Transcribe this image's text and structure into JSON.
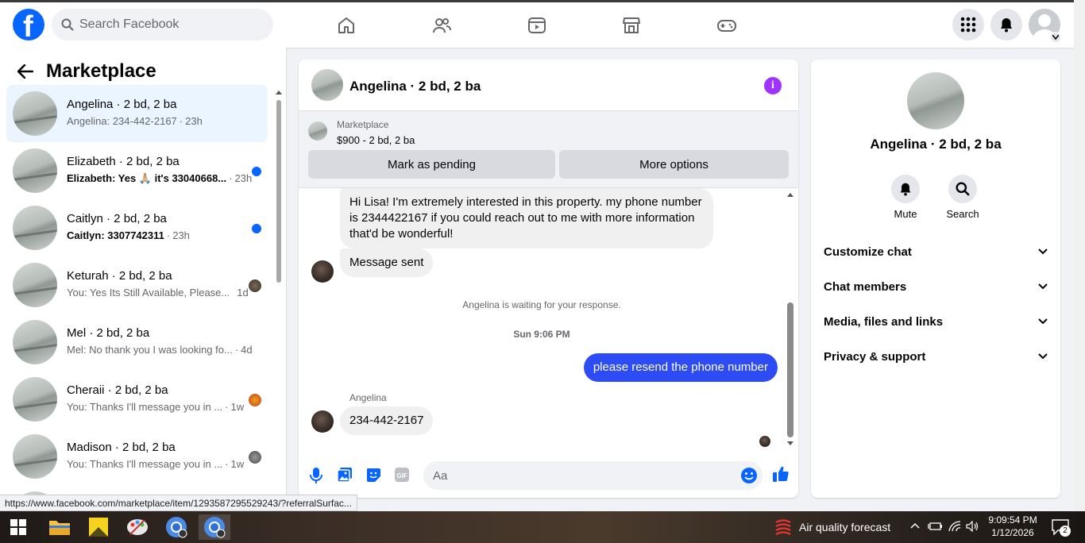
{
  "header": {
    "search_placeholder": "Search Facebook",
    "nav_icons": [
      "home-icon",
      "friends-icon",
      "video-icon",
      "marketplace-icon",
      "gaming-icon"
    ],
    "right_icons": [
      "menu-grid-icon",
      "notifications-icon",
      "account-avatar"
    ]
  },
  "sidebar": {
    "title": "Marketplace",
    "conversations": [
      {
        "name": "Angelina · 2 bd, 2 ba",
        "snippet": "Angelina: 234-442-2167",
        "time": "23h",
        "unread": false,
        "active": true
      },
      {
        "name": "Elizabeth · 2 bd, 2 ba",
        "snippet": "Elizabeth: Yes 🙏🏼 it's 33040668...",
        "time": "23h",
        "unread": true
      },
      {
        "name": "Caitlyn · 2 bd, 2 ba",
        "snippet": "Caitlyn: 3307742311",
        "time": "23h",
        "unread": true
      },
      {
        "name": "Keturah · 2 bd, 2 ba",
        "snippet": "You: Yes Its Still Available, Please...",
        "time": "1d",
        "unread": false
      },
      {
        "name": "Mel · 2 bd, 2 ba",
        "snippet": "Mel: No thank you I was looking fo...",
        "time": "4d",
        "unread": false
      },
      {
        "name": "Cheraii · 2 bd, 2 ba",
        "snippet": "You: Thanks I'll message you in ...",
        "time": "1w",
        "unread": false
      },
      {
        "name": "Madison · 2 bd, 2 ba",
        "snippet": "You: Thanks I'll message you in ...",
        "time": "1w",
        "unread": false
      }
    ]
  },
  "chat": {
    "title": "Angelina · 2 bd, 2 ba",
    "marketplace_label": "Marketplace",
    "listing": "$900 - 2 bd, 2 ba",
    "mark_pending": "Mark as pending",
    "more_options": "More options",
    "messages": {
      "m1": "Hi Lisa! I'm extremely interested in this property. my phone number is 2344422167 if you could reach out to me with more information that'd be wonderful!",
      "m2": "Message sent",
      "waiting": "Angelina is waiting for your response.",
      "timestamp": "Sun 9:06 PM",
      "m3": "please resend the phone number",
      "sender": "Angelina",
      "m4": "234-442-2167"
    },
    "composer_placeholder": "Aa"
  },
  "details": {
    "name": "Angelina · 2 bd, 2 ba",
    "mute": "Mute",
    "search": "Search",
    "sections": [
      "Customize chat",
      "Chat members",
      "Media, files and links",
      "Privacy & support"
    ]
  },
  "status_url": "https://www.facebook.com/marketplace/item/1293587295529243/?referralSurfac...",
  "taskbar": {
    "weather": "Air quality forecast",
    "time": "9:09:54 PM",
    "date": "1/12/2026",
    "notifications": "2"
  },
  "colors": {
    "brand": "#0866ff",
    "outgoing_bubble": "#2e4cf6",
    "info": "#a033ff"
  }
}
